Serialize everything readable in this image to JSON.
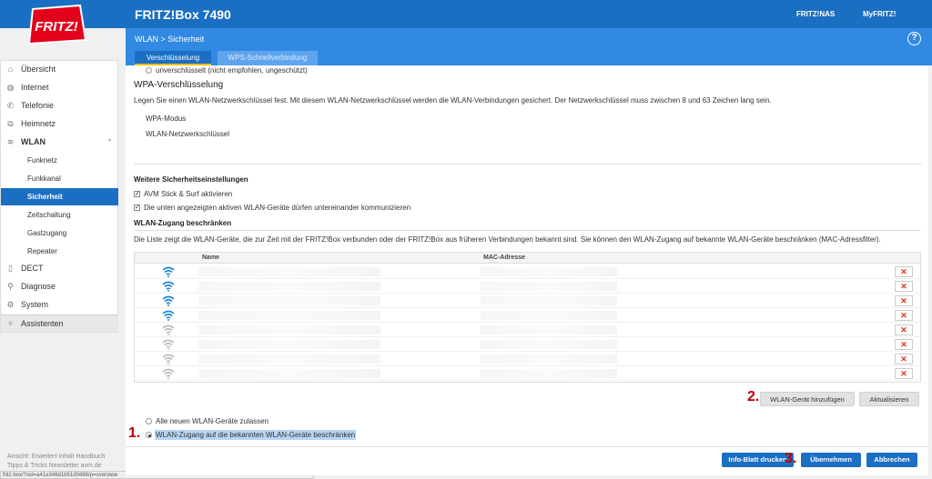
{
  "header": {
    "title": "FRITZ!Box 7490",
    "links": [
      "FRITZ!NAS",
      "MyFRITZ!"
    ],
    "logo_text": "FRITZ!"
  },
  "breadcrumb": "WLAN > Sicherheit",
  "help": "?",
  "tabs": [
    "Verschlüsselung",
    "WPS-Schnellverbindung"
  ],
  "sidebar": {
    "items": [
      {
        "label": "Übersicht",
        "icon": "home-icon"
      },
      {
        "label": "Internet",
        "icon": "globe-icon"
      },
      {
        "label": "Telefonie",
        "icon": "phone-icon"
      },
      {
        "label": "Heimnetz",
        "icon": "network-icon"
      },
      {
        "label": "WLAN",
        "icon": "wifi-icon"
      },
      {
        "label": "Funknetz"
      },
      {
        "label": "Funkkanal"
      },
      {
        "label": "Sicherheit"
      },
      {
        "label": "Zeitschaltung"
      },
      {
        "label": "Gastzugang"
      },
      {
        "label": "Repeater"
      },
      {
        "label": "DECT",
        "icon": "dect-icon"
      },
      {
        "label": "Diagnose",
        "icon": "diagnose-icon"
      },
      {
        "label": "System",
        "icon": "system-icon"
      },
      {
        "label": "Assistenten",
        "icon": "wizard-icon"
      }
    ],
    "chevron": "⌃"
  },
  "footer": {
    "line1": "Ansicht: Erweitert   Inhalt   Handbuch",
    "line2": "Tipps & Tricks   Newsletter   avm.de"
  },
  "status_url": "fritz.box/?sid=a41e346d1b51d0488/p=overview",
  "main": {
    "unencrypted_label": "unverschlüsselt  (nicht empfohlen, ungeschützt)",
    "wpa_heading": "WPA-Verschlüsselung",
    "wpa_desc": "Legen Sie einen WLAN-Netzwerkschlüssel fest. Mit diesem WLAN-Netzwerkschlüssel werden die WLAN-Verbindungen gesichert. Der Netzwerkschlüssel muss zwischen 8 und 63 Zeichen lang sein.",
    "wpa_mode_label": "WPA-Modus",
    "wlan_key_label": "WLAN-Netzwerkschlüssel",
    "further_heading": "Weitere Sicherheitseinstellungen",
    "check1": "AVM Stick & Surf aktivieren",
    "check2": "Die unten angezeigten aktiven WLAN-Geräte dürfen untereinander kommunizieren",
    "restrict_heading": "WLAN-Zugang beschränken",
    "restrict_desc": "Die Liste zeigt die WLAN-Geräte, die zur Zeit mit der FRITZ!Box verbunden oder der FRITZ!Box aus früheren Verbindungen bekannt sind. Sie können den WLAN-Zugang auf bekannte WLAN-Geräte beschränken (MAC-Adressfilter).",
    "col_name": "Name",
    "col_mac": "MAC-Adresse",
    "delete_symbol": "✕",
    "btn_add": "WLAN-Gerät hinzufügen",
    "btn_refresh": "Aktualisieren",
    "radio_allow": "Alle neuen WLAN-Geräte zulassen",
    "radio_restrict": "WLAN-Zugang auf die bekannten WLAN-Geräte beschränken",
    "btn_info": "Info-Blatt drucken",
    "btn_apply": "Übernehmen",
    "btn_cancel": "Abbrechen",
    "marks": [
      "1.",
      "2.",
      "3."
    ]
  },
  "devices": [
    {
      "active": true
    },
    {
      "active": true
    },
    {
      "active": true
    },
    {
      "active": true
    },
    {
      "active": false
    },
    {
      "active": false
    },
    {
      "active": false
    },
    {
      "active": false
    }
  ],
  "colors": {
    "brand": "#1b6fc2",
    "accent_light": "#3189e4",
    "logo_red": "#e2001a",
    "wifi_active": "#1b88d8",
    "wifi_inactive": "#bbbbbb"
  }
}
